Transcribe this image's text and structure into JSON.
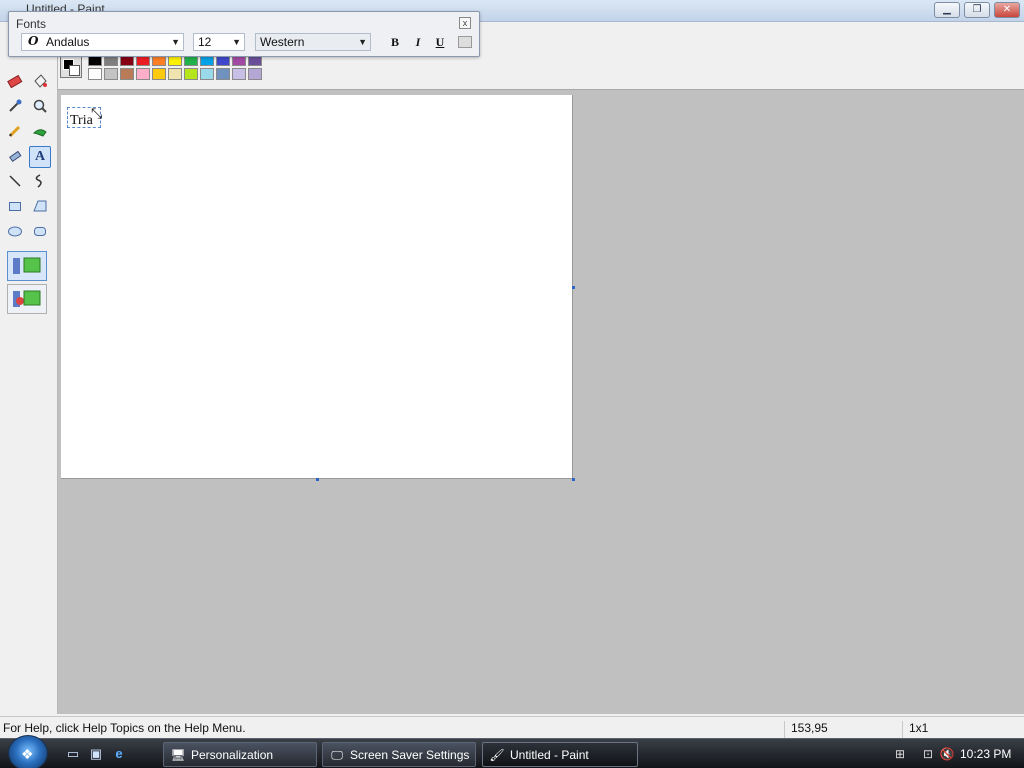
{
  "window": {
    "title": "Untitled - Paint",
    "minimize_label": "▁",
    "restore_label": "❐",
    "close_label": "✕"
  },
  "fonts_toolbar": {
    "title": "Fonts",
    "close_label": "x",
    "font_name": "Andalus",
    "font_size": "12",
    "script": "Western",
    "bold_label": "B",
    "italic_label": "I",
    "underline_label": "U"
  },
  "canvas": {
    "typed_text": "Tria"
  },
  "palette": {
    "foreground": "#000000",
    "background": "#ffffff",
    "row1": [
      "#000000",
      "#7f7f7f",
      "#880015",
      "#ed1c24",
      "#ff7f27",
      "#fff200",
      "#22b14c",
      "#00a2e8",
      "#3f48cc",
      "#a349a4",
      "#6b4e9a"
    ],
    "row2": [
      "#ffffff",
      "#c3c3c3",
      "#b97a57",
      "#ffaec9",
      "#ffc90e",
      "#efe4b0",
      "#b5e61d",
      "#99d9ea",
      "#7092be",
      "#c8bfe7",
      "#b4a7d6"
    ]
  },
  "status": {
    "help_text": "For Help, click Help Topics on the Help Menu.",
    "coordinates": "153,95",
    "size": "1x1"
  },
  "taskbar": {
    "items": [
      {
        "label": "Personalization"
      },
      {
        "label": "Screen Saver Settings"
      },
      {
        "label": "Untitled - Paint"
      }
    ],
    "clock": "10:23 PM"
  }
}
